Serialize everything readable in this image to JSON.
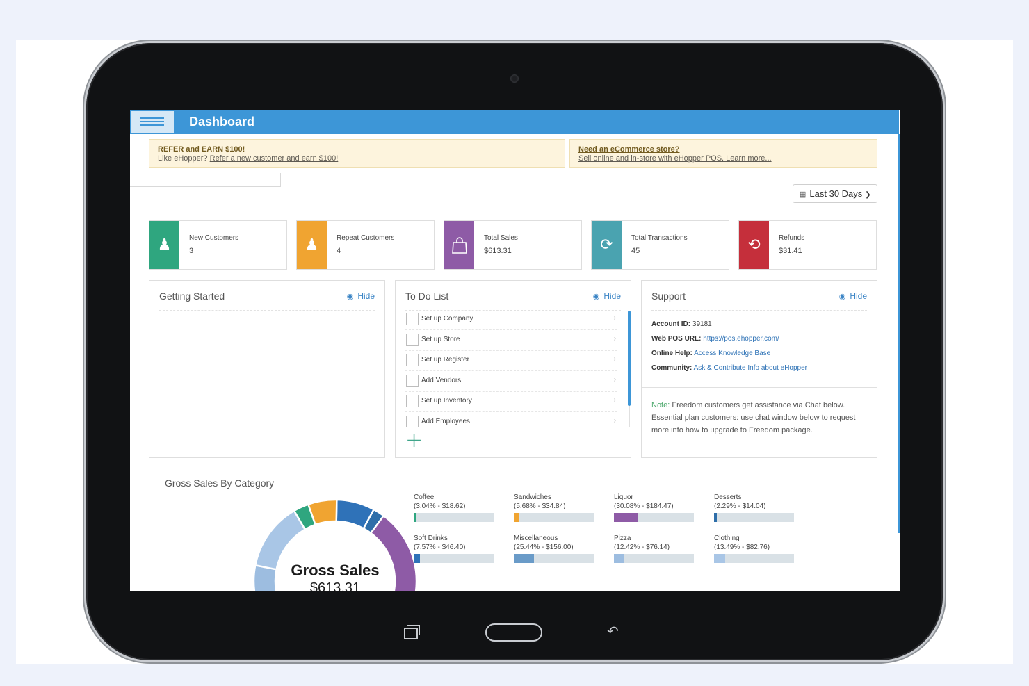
{
  "header": {
    "title": "Dashboard",
    "menu_icon": "hamburger-menu-icon"
  },
  "banners": {
    "refer": {
      "title": "REFER and EARN $100!",
      "text": "Like eHopper?",
      "link": "Refer a new customer and earn $100!"
    },
    "ecommerce": {
      "title": "Need an eCommerce store?",
      "link": "Sell online and in-store with eHopper POS. Learn more..."
    }
  },
  "date_range": {
    "label": "Last 30 Days",
    "icon": "calendar-icon"
  },
  "kpis": [
    {
      "label": "New Customers",
      "value": "3",
      "color": "#2fa67f",
      "icon": "new-customer-icon"
    },
    {
      "label": "Repeat Customers",
      "value": "4",
      "color": "#f0a431",
      "icon": "repeat-customer-icon"
    },
    {
      "label": "Total Sales",
      "value": "$613.31",
      "color": "#8e5ba6",
      "icon": "shopping-bag-icon"
    },
    {
      "label": "Total Transactions",
      "value": "45",
      "color": "#4aa3b0",
      "icon": "refresh-icon"
    },
    {
      "label": "Refunds",
      "value": "$31.41",
      "color": "#c52f3b",
      "icon": "refund-icon"
    }
  ],
  "getting_started": {
    "title": "Getting Started",
    "hide_label": "Hide"
  },
  "todo": {
    "title": "To Do List",
    "hide_label": "Hide",
    "items": [
      "Set up Company",
      "Set up Store",
      "Set up Register",
      "Add Vendors",
      "Set up Inventory",
      "Add Employees"
    ]
  },
  "support": {
    "title": "Support",
    "hide_label": "Hide",
    "account_label": "Account ID:",
    "account_value": "39181",
    "url_label": "Web POS URL:",
    "url_value": "https://pos.ehopper.com/",
    "help_label": "Online Help:",
    "help_value": "Access Knowledge Base",
    "community_label": "Community:",
    "community_value": "Ask & Contribute Info about eHopper",
    "note_label": "Note:",
    "note_text": "Freedom customers get assistance via Chat below. Essential plan customers: use chat window below to request more info how to upgrade to Freedom package."
  },
  "gross_sales": {
    "title": "Gross Sales By Category",
    "donut_label": "Gross Sales",
    "donut_value": "$613.31",
    "categories": [
      {
        "name": "Coffee",
        "detail": "(3.04% - $18.62)",
        "percent": 3.04,
        "color": "#2fa67f"
      },
      {
        "name": "Sandwiches",
        "detail": "(5.68% - $34.84)",
        "percent": 5.68,
        "color": "#f0a431"
      },
      {
        "name": "Liquor",
        "detail": "(30.08% - $184.47)",
        "percent": 30.08,
        "color": "#8e5ba6"
      },
      {
        "name": "Desserts",
        "detail": "(2.29% - $14.04)",
        "percent": 2.29,
        "color": "#2e6ea9"
      },
      {
        "name": "Soft Drinks",
        "detail": "(7.57% - $46.40)",
        "percent": 7.57,
        "color": "#2f72b8"
      },
      {
        "name": "Miscellaneous",
        "detail": "(25.44% - $156.00)",
        "percent": 25.44,
        "color": "#6a9bc8"
      },
      {
        "name": "Pizza",
        "detail": "(12.42% - $76.14)",
        "percent": 12.42,
        "color": "#9dbde0"
      },
      {
        "name": "Clothing",
        "detail": "(13.49% - $82.76)",
        "percent": 13.49,
        "color": "#a9c6e6"
      }
    ]
  },
  "device_nav": {
    "recent_icon": "recent-apps-icon",
    "home_icon": "home-button-icon",
    "back_icon": "back-icon"
  }
}
